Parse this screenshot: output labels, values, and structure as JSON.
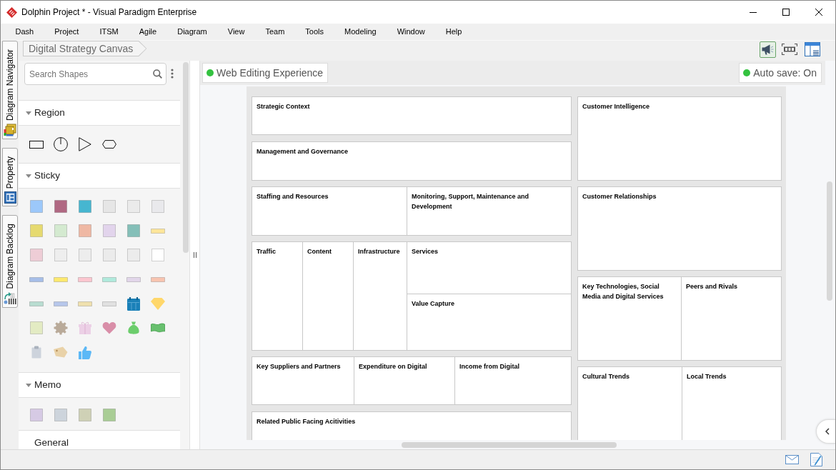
{
  "window": {
    "title": "Dolphin Project * - Visual Paradigm Enterprise"
  },
  "menu_bar": [
    "Dash",
    "Project",
    "ITSM",
    "Agile",
    "Diagram",
    "View",
    "Team",
    "Tools",
    "Modeling",
    "Window",
    "Help"
  ],
  "side_tabs": [
    {
      "label": "Diagram Navigator",
      "kind": "navigator"
    },
    {
      "label": "Property",
      "kind": "property"
    },
    {
      "label": "Diagram Backlog",
      "kind": "backlog"
    }
  ],
  "breadcrumb": [
    "Digital Strategy Canvas"
  ],
  "toolbar": [
    {
      "kind": "megaphone",
      "on": true
    },
    {
      "kind": "fit",
      "on": false
    },
    {
      "kind": "layout",
      "on": false
    }
  ],
  "palette": {
    "search": {
      "placeholder": "Search Shapes"
    },
    "sections": [
      {
        "title": "Region",
        "expanded": true,
        "shapes": [
          {
            "kind": "rectangle"
          },
          {
            "kind": "dial"
          },
          {
            "kind": "triangle"
          },
          {
            "kind": "hexagon"
          }
        ]
      },
      {
        "title": "Sticky",
        "expanded": true,
        "shapes": [
          {
            "kind": "note",
            "color": "#9cc8fa"
          },
          {
            "kind": "note",
            "color": "#b06882"
          },
          {
            "kind": "note",
            "color": "#46b6d0"
          },
          {
            "kind": "note",
            "color": "#e6e6e6"
          },
          {
            "kind": "note",
            "color": "#ebebeb"
          },
          {
            "kind": "note",
            "color": "#e9e9ec"
          },
          {
            "kind": "note",
            "color": "#e6da70"
          },
          {
            "kind": "note",
            "color": "#d4ead0"
          },
          {
            "kind": "note",
            "color": "#efb8a4"
          },
          {
            "kind": "note",
            "color": "#e2d4ec"
          },
          {
            "kind": "note",
            "color": "#84bfb8"
          },
          {
            "kind": "tape",
            "color": "#fde59a"
          },
          {
            "kind": "note",
            "color": "#eecdd6"
          },
          {
            "kind": "note",
            "color": "#eeeeee"
          },
          {
            "kind": "note",
            "color": "#ededed"
          },
          {
            "kind": "note",
            "color": "#ebebeb"
          },
          {
            "kind": "note",
            "color": "#ececec"
          },
          {
            "kind": "note",
            "color": "#ffffff"
          },
          {
            "kind": "tape",
            "color": "#a6bee8"
          },
          {
            "kind": "tape",
            "color": "#fde96e"
          },
          {
            "kind": "tape",
            "color": "#fcc6cf"
          },
          {
            "kind": "tape",
            "color": "#b0eadc"
          },
          {
            "kind": "tape",
            "color": "#e2d6ea"
          },
          {
            "kind": "tape",
            "color": "#f8c4b0"
          },
          {
            "kind": "tape",
            "color": "#b8dcd0"
          },
          {
            "kind": "tape",
            "color": "#b6c6ea"
          },
          {
            "kind": "tape",
            "color": "#efe0ae"
          },
          {
            "kind": "tape",
            "color": "#e0e0e0"
          },
          {
            "kind": "calendar",
            "color": "#1a80b8"
          },
          {
            "kind": "gem",
            "color": "#ffd76a"
          },
          {
            "kind": "note",
            "color": "#e3ebc3"
          },
          {
            "kind": "cog",
            "color": "#b9aa99"
          },
          {
            "kind": "gift",
            "color": "#ecd0e6"
          },
          {
            "kind": "heart",
            "color": "#d98ea8"
          },
          {
            "kind": "bag",
            "color": "#6ccd6c"
          },
          {
            "kind": "banknote",
            "color": "#68c06e"
          },
          {
            "kind": "clipboard",
            "color": "#cdd3dc"
          },
          {
            "kind": "tag",
            "color": "#e9d2a8"
          },
          {
            "kind": "thumb",
            "color": "#5cb8f6"
          }
        ]
      },
      {
        "title": "Memo",
        "expanded": true,
        "shapes": [
          {
            "kind": "note",
            "color": "#d6cae4"
          },
          {
            "kind": "note",
            "color": "#cdd4dc"
          },
          {
            "kind": "note",
            "color": "#cfd1b6"
          },
          {
            "kind": "note",
            "color": "#a9cd95"
          }
        ]
      },
      {
        "title": "General"
      }
    ]
  },
  "canvas": {
    "banner": "Web Editing Experience",
    "autosave": "Auto save: On",
    "left_column": [
      "Strategic Context",
      "Management and Governance",
      "Staffing and Resources",
      "Monitoring, Support, Maintenance and Development",
      "Traffic",
      "Content",
      "Infrastructure",
      "Services",
      "Value Capture",
      "Key Suppliers and Partners",
      "Expenditure on Digital",
      "Income from Digital",
      "Related Public Facing Acitivities"
    ],
    "right_column": [
      "Customer Intelligence",
      "Customer Relationships",
      "Key Technologies, Social Media and Digital Services",
      "Peers and Rivals",
      "Cultural Trends",
      "Local Trends"
    ]
  }
}
